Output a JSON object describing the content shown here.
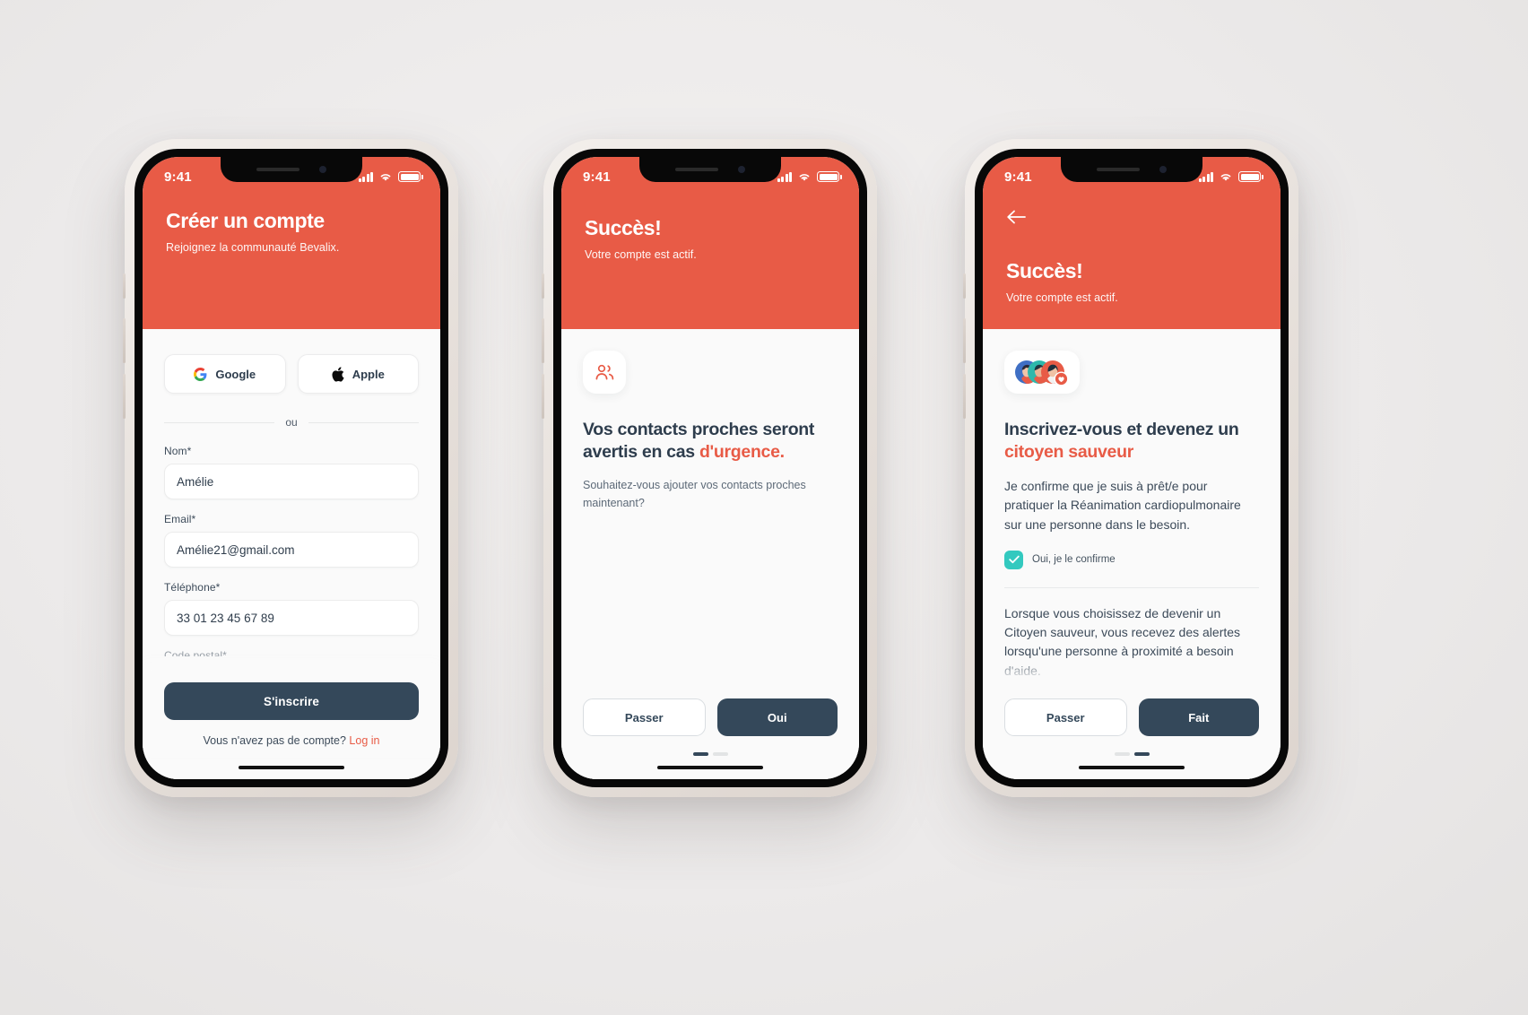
{
  "theme": {
    "brand_red": "#e85b46",
    "dark_navy": "#34485a",
    "teal": "#33c9bf"
  },
  "status_bar": {
    "time": "9:41",
    "signal_icon": "cellular-bars-icon",
    "wifi_icon": "wifi-icon",
    "battery_icon": "battery-icon"
  },
  "phone1": {
    "hero": {
      "title": "Créer un compte",
      "subtitle": "Rejoignez la communauté Bevalix."
    },
    "oauth": [
      {
        "label": "Google",
        "icon": "google-icon"
      },
      {
        "label": "Apple",
        "icon": "apple-icon"
      }
    ],
    "divider_label": "ou",
    "fields": [
      {
        "label": "Nom*",
        "value": "Amélie"
      },
      {
        "label": "Email*",
        "value": "Amélie21@gmail.com"
      },
      {
        "label": "Téléphone*",
        "value": "33 01 23 45 67 89"
      }
    ],
    "clipped_field_label": "Code postal*",
    "submit_label": "S'inscrire",
    "footer_text": "Vous n'avez pas de compte?",
    "footer_link": "Log in"
  },
  "phone2": {
    "hero": {
      "title": "Succès!",
      "subtitle": "Votre compte est actif."
    },
    "icon": "contacts-people-icon",
    "heading_part1": "Vos contacts proches seront avertis en cas ",
    "heading_accent": "d'urgence.",
    "paragraph": "Souhaitez-vous ajouter vos contacts proches maintenant?",
    "buttons": {
      "secondary": "Passer",
      "primary": "Oui"
    },
    "pagination": {
      "total": 2,
      "active": 1
    }
  },
  "phone3": {
    "hero": {
      "title": "Succès!",
      "subtitle": "Votre compte est actif.",
      "back_icon": "back-arrow-icon"
    },
    "icon": "avatar-group-heart-icon",
    "heading_part1": "Inscrivez-vous et devenez un ",
    "heading_accent": "citoyen sauveur",
    "paragraph": "Je confirme que je suis à prêt/e pour pratiquer la Réanimation cardiopulmonaire sur une personne dans le besoin.",
    "checkbox": {
      "label": "Oui, je le confirme",
      "checked": true,
      "icon": "check-icon"
    },
    "paragraph2": "Lorsque vous choisissez de devenir un Citoyen sauveur, vous recevez des alertes lorsqu'une personne à proximité a besoin d'aide.",
    "buttons": {
      "secondary": "Passer",
      "primary": "Fait"
    },
    "pagination": {
      "total": 2,
      "active": 2
    }
  }
}
